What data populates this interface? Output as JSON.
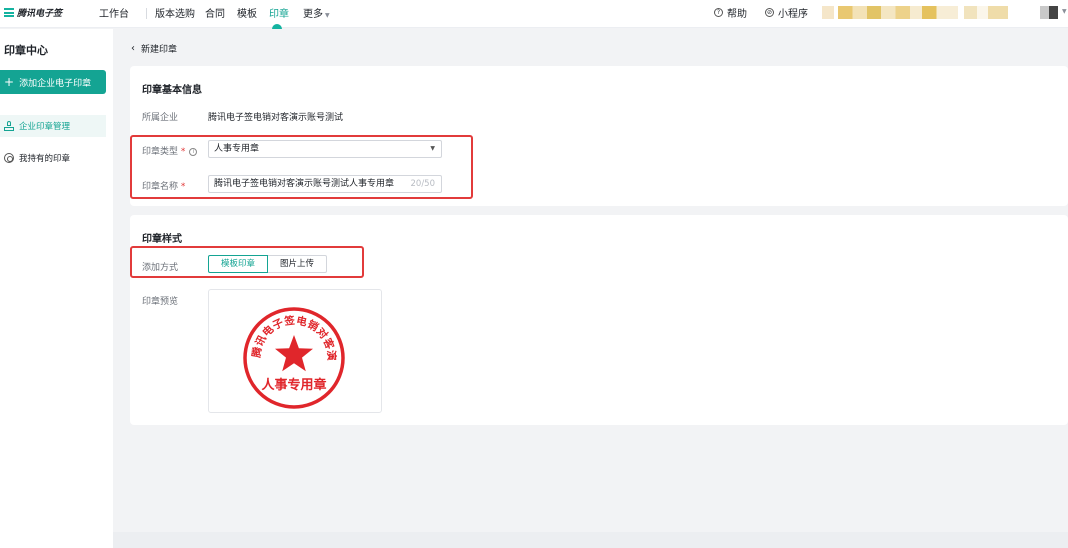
{
  "header": {
    "logo_text": "腾讯电子签",
    "nav": [
      {
        "label": "工作台"
      },
      {
        "label": "版本选购"
      },
      {
        "label": "合同"
      },
      {
        "label": "模板"
      },
      {
        "label": "印章"
      },
      {
        "label": "更多"
      }
    ],
    "active_nav": "印章",
    "help_label": "帮助",
    "mini_program_label": "小程序",
    "accent_color": "#14a493"
  },
  "sidebar": {
    "title": "印章中心",
    "add_button_label": "添加企业电子印章",
    "items": [
      {
        "label": "企业印章管理",
        "selected": true,
        "icon": "seal-icon"
      },
      {
        "label": "我持有的印章",
        "selected": false,
        "icon": "ring-icon"
      }
    ]
  },
  "page": {
    "back_label": "新建印章",
    "basic": {
      "title": "印章基本信息",
      "company_label": "所属企业",
      "company_value": "腾讯电子签电销对客演示账号测试",
      "type_label": "印章类型",
      "type_required": "*",
      "type_value": "人事专用章",
      "name_label": "印章名称",
      "name_required": "*",
      "name_value": "腾讯电子签电销对客演示账号测试人事专用章",
      "name_count": "20/50"
    },
    "style": {
      "title": "印章样式",
      "method_label": "添加方式",
      "method_options": [
        "模板印章",
        "图片上传"
      ],
      "method_selected": "模板印章",
      "preview_label": "印章预览",
      "seal_ring_text": "腾讯电子签电销对客演示账号测试",
      "seal_bottom_text": "人事专用章",
      "seal_color": "#e0262b"
    }
  }
}
